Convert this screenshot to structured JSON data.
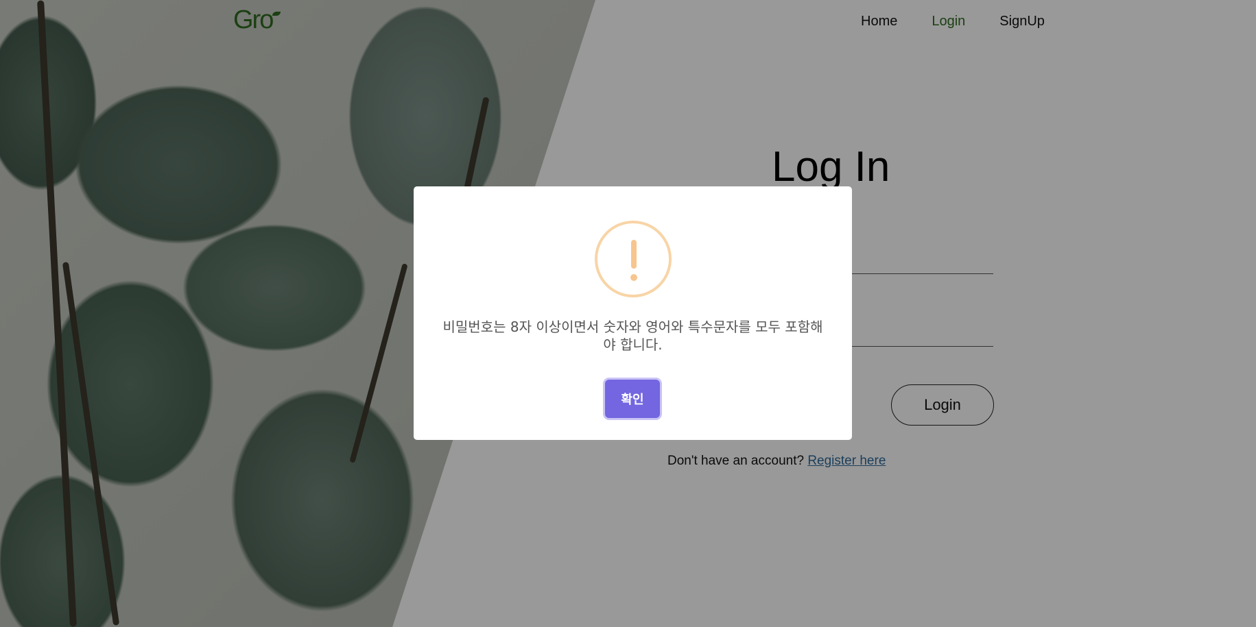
{
  "header": {
    "logo": "Gro"
  },
  "nav": {
    "items": [
      {
        "label": "Home"
      },
      {
        "label": "Login"
      },
      {
        "label": "SignUp"
      }
    ]
  },
  "login": {
    "title": "Log In",
    "button_label": "Login",
    "register_prompt": "Don't have an account?",
    "register_link": "Register here"
  },
  "modal": {
    "icon": "exclamation-icon",
    "message": "비밀번호는 8자 이상이면서 숫자와 영어와 특수문자를 모두 포함해야 합니다.",
    "confirm_label": "확인"
  },
  "colors": {
    "brand_green": "#2e6b1e",
    "confirm_button": "#7366e0",
    "warning_icon": "#f7c58f",
    "link": "#2f6a99"
  }
}
